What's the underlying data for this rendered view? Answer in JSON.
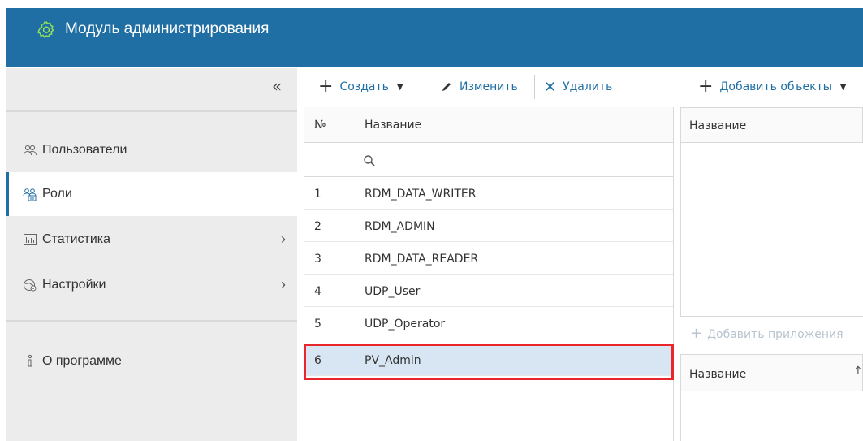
{
  "header": {
    "title": "Модуль администрирования"
  },
  "sidebar": {
    "collapse_label": "«",
    "items": [
      {
        "label": "Пользователи",
        "icon": "users-icon"
      },
      {
        "label": "Роли",
        "icon": "roles-icon",
        "active": true
      },
      {
        "label": "Статистика",
        "icon": "statistics-icon",
        "chevron": "›"
      },
      {
        "label": "Настройки",
        "icon": "settings-icon",
        "chevron": "›"
      },
      {
        "label": "О программе",
        "icon": "info-icon"
      }
    ]
  },
  "toolbar": {
    "create_label": "Создать",
    "edit_label": "Изменить",
    "delete_label": "Удалить",
    "add_objects_label": "Добавить объекты"
  },
  "grid": {
    "columns": {
      "num": "№",
      "name": "Название"
    },
    "rows": [
      {
        "num": "1",
        "name": "RDM_DATA_WRITER"
      },
      {
        "num": "2",
        "name": "RDM_ADMIN"
      },
      {
        "num": "3",
        "name": "RDM_DATA_READER"
      },
      {
        "num": "4",
        "name": "UDP_User"
      },
      {
        "num": "5",
        "name": "UDP_Operator"
      },
      {
        "num": "6",
        "name": "PV_Admin",
        "selected": true
      }
    ]
  },
  "right_panel": {
    "objects_header": "Название",
    "add_apps_label": "Добавить приложения",
    "apps_header": "Название"
  },
  "colors": {
    "header_bg": "#1f6fa4",
    "selection": "#d8e6f3",
    "highlight_border": "#e8262c"
  }
}
